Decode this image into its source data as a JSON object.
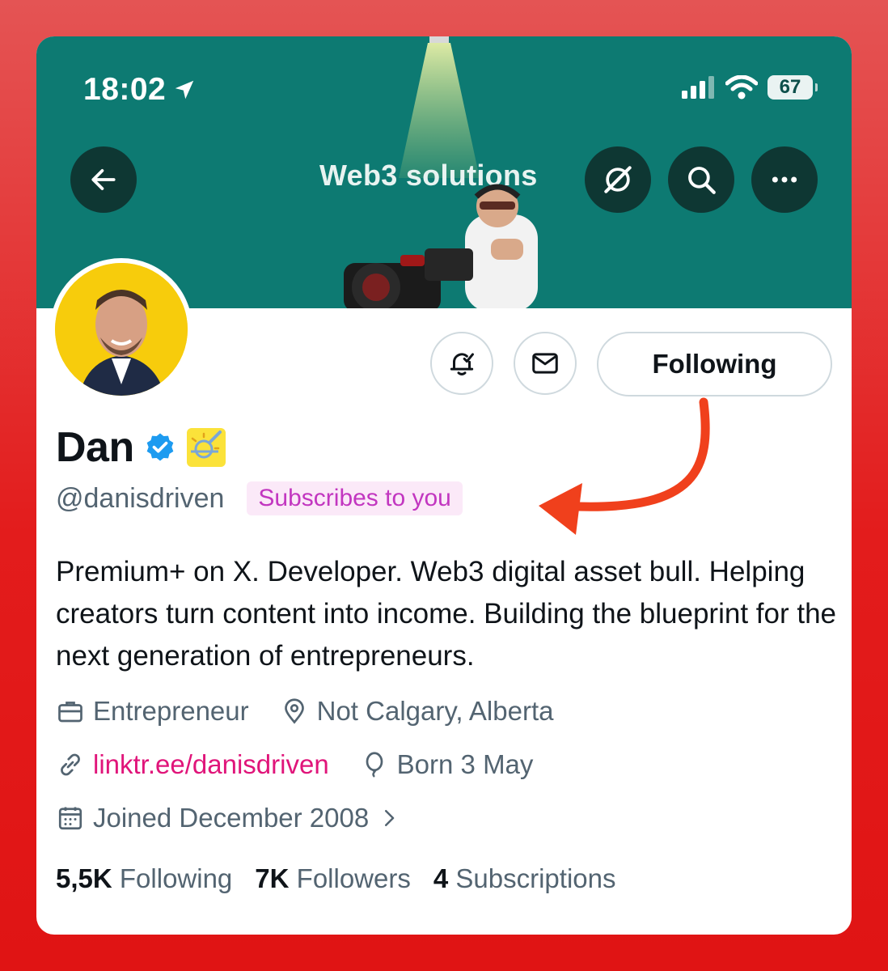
{
  "status_bar": {
    "time": "18:02",
    "battery": "67"
  },
  "header": {
    "banner_text": "Web3 solutions"
  },
  "actions": {
    "follow_label": "Following"
  },
  "profile": {
    "name": "Dan",
    "handle": "@danisdriven",
    "badge": "Subscribes to you",
    "bio": "Premium+ on X. Developer. Web3 digital asset bull. Helping creators turn content into income. Building the blueprint for the next generation of entrepreneurs.",
    "category": "Entrepreneur",
    "location": "Not Calgary, Alberta",
    "link": "linktr.ee/danisdriven",
    "birthday": "Born 3 May",
    "joined": "Joined December 2008"
  },
  "stats": {
    "following_count": "5,5K",
    "following_label": "Following",
    "followers_count": "7K",
    "followers_label": "Followers",
    "subscriptions_count": "4",
    "subscriptions_label": "Subscriptions"
  },
  "colors": {
    "banner": "#0d7a72",
    "verified": "#1d9bf0",
    "link": "#e0157a",
    "badge_text": "#c236c0",
    "arrow": "#f0401c",
    "frame": "#e31c1c"
  },
  "icons": [
    "back-arrow-icon",
    "no-grok-icon",
    "search-icon",
    "more-icon",
    "bell-icon",
    "mail-icon",
    "verified-icon",
    "emoji-badge-icon",
    "briefcase-icon",
    "location-icon",
    "link-icon",
    "balloon-icon",
    "calendar-icon",
    "chevron-right-icon"
  ]
}
